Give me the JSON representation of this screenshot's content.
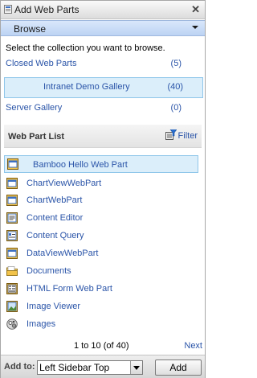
{
  "window": {
    "title": "Add Web Parts",
    "close_glyph": "✕"
  },
  "menu": {
    "label": "Browse"
  },
  "intro": "Select the collection you want to browse.",
  "collections": [
    {
      "name": "Closed Web Parts",
      "count": "(5)",
      "selected": false
    },
    {
      "name": "Intranet Demo Gallery",
      "count": "(40)",
      "selected": true
    },
    {
      "name": "Server Gallery",
      "count": "(0)",
      "selected": false
    }
  ],
  "list": {
    "title": "Web Part List",
    "filter_label": "Filter",
    "items": [
      {
        "label": "Bamboo Hello Web Part",
        "icon": "webpart-icon",
        "selected": true
      },
      {
        "label": "ChartViewWebPart",
        "icon": "webpart-icon"
      },
      {
        "label": "ChartWebPart",
        "icon": "webpart-icon"
      },
      {
        "label": "Content Editor",
        "icon": "content-editor-icon"
      },
      {
        "label": "Content Query",
        "icon": "content-query-icon"
      },
      {
        "label": "DataViewWebPart",
        "icon": "webpart-icon"
      },
      {
        "label": "Documents",
        "icon": "folder-icon"
      },
      {
        "label": "HTML Form Web Part",
        "icon": "form-icon"
      },
      {
        "label": "Image Viewer",
        "icon": "image-icon"
      },
      {
        "label": "Images",
        "icon": "images-library-icon"
      }
    ]
  },
  "pager": {
    "text": "1 to 10 (of 40)",
    "next": "Next"
  },
  "footer": {
    "label": "Add to:",
    "zone": "Left Sidebar Top",
    "add_button": "Add"
  },
  "colors": {
    "link": "#2a54a8",
    "selection_bg": "#dbeefa",
    "selection_border": "#8fc6ea",
    "menu_bar": "#c8dcf6"
  }
}
